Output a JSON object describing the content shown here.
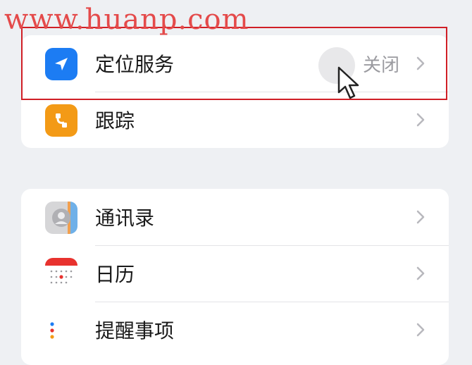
{
  "watermark": "www.huanp.com",
  "groups": [
    {
      "rows": [
        {
          "label": "定位服务",
          "value": "关闭",
          "icon": "location-arrow-icon",
          "color": "#1c7cf3"
        },
        {
          "label": "跟踪",
          "value": "",
          "icon": "tracking-icon",
          "color": "#f39a16"
        }
      ]
    },
    {
      "rows": [
        {
          "label": "通讯录",
          "value": "",
          "icon": "contacts-icon",
          "color": "#d8d8d8"
        },
        {
          "label": "日历",
          "value": "",
          "icon": "calendar-icon",
          "color": "#ffffff"
        },
        {
          "label": "提醒事项",
          "value": "",
          "icon": "reminders-icon",
          "color": "#ffffff"
        }
      ]
    }
  ]
}
